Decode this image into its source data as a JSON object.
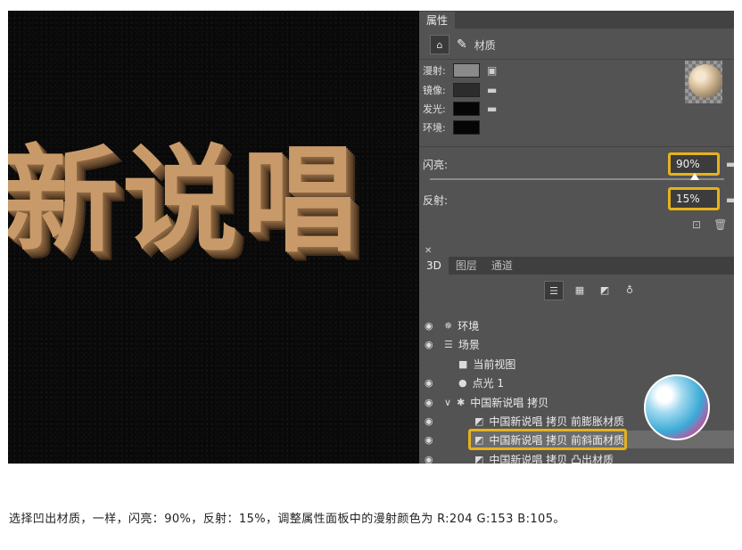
{
  "canvas": {
    "headline": "新说唱"
  },
  "properties": {
    "tab": "属性",
    "mode_label": "材质",
    "rows": [
      {
        "label": "漫射:",
        "color": "#8a8a8a"
      },
      {
        "label": "镜像:",
        "color": "#2c2c2c"
      },
      {
        "label": "发光:",
        "color": "#050505"
      },
      {
        "label": "环境:",
        "color": "#050505"
      }
    ],
    "shine_label": "闪亮:",
    "shine_value": "90%",
    "shine_level": 0.9,
    "reflect_label": "反射:",
    "reflect_value": "15%"
  },
  "panel3d": {
    "tabs": [
      "3D",
      "图层",
      "通道"
    ],
    "layers": [
      {
        "label": "环境",
        "icon": "environment-icon"
      },
      {
        "label": "场景",
        "icon": "scene-icon"
      },
      {
        "label": "当前视图",
        "icon": "camera-icon"
      },
      {
        "label": "点光 1",
        "icon": "point-light-icon"
      },
      {
        "label": "中国新说唱 拷贝",
        "icon": "mesh-icon"
      },
      {
        "label": "中国新说唱 拷贝 前膨胀材质",
        "icon": "material-icon"
      },
      {
        "label": "中国新说唱 拷贝 前斜面材质",
        "icon": "material-icon"
      },
      {
        "label": "中国新说唱 拷贝 凸出材质",
        "icon": "material-icon"
      }
    ]
  },
  "caption": "选择凹出材质，一样，闪亮：90%，反射：15%，调整属性面板中的漫射颜色为 R:204 G:153 B:105。",
  "colors": {
    "highlight": "#e6b21c",
    "text_color": "#c99a69"
  }
}
